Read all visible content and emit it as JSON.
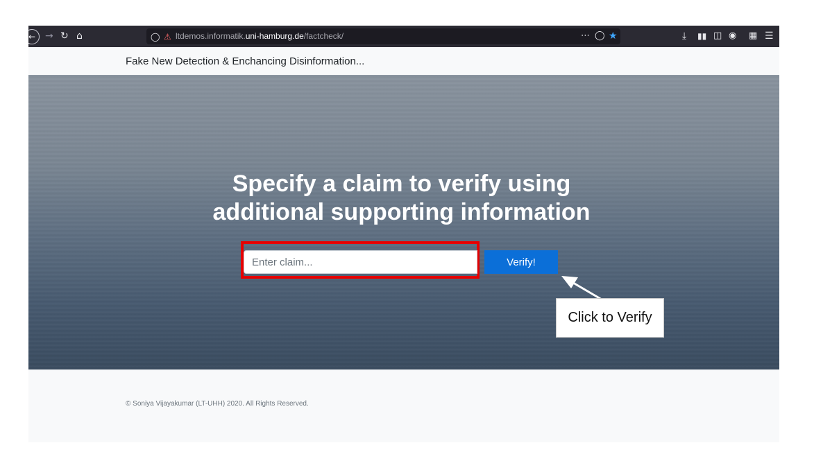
{
  "browser": {
    "url_prefix": "ltdemos.informatik.",
    "url_host": "uni-hamburg.de",
    "url_path": "/factcheck/",
    "icons": [
      "back-icon",
      "forward-icon",
      "reload-icon",
      "home-icon",
      "shield-icon",
      "insecure-lock-icon",
      "more-icon",
      "pocket-icon",
      "bookmark-star-icon",
      "download-icon",
      "library-icon",
      "sidebar-icon",
      "account-icon",
      "extensions-icon",
      "menu-icon"
    ],
    "accent": "#2b2a33"
  },
  "navbar": {
    "brand": "Fake New Detection & Enchancing Disinformation..."
  },
  "hero": {
    "title_line1": "Specify a claim to verify using",
    "title_line2": "additional supporting information",
    "input_placeholder": "Enter claim...",
    "verify_label": "Verify!",
    "highlight_color": "#e60000",
    "button_color": "#0b6fd8"
  },
  "annotation": {
    "callout_text": "Click to Verify"
  },
  "footer": {
    "copyright": "© Soniya Vijayakumar (LT-UHH) 2020. All Rights Reserved."
  }
}
